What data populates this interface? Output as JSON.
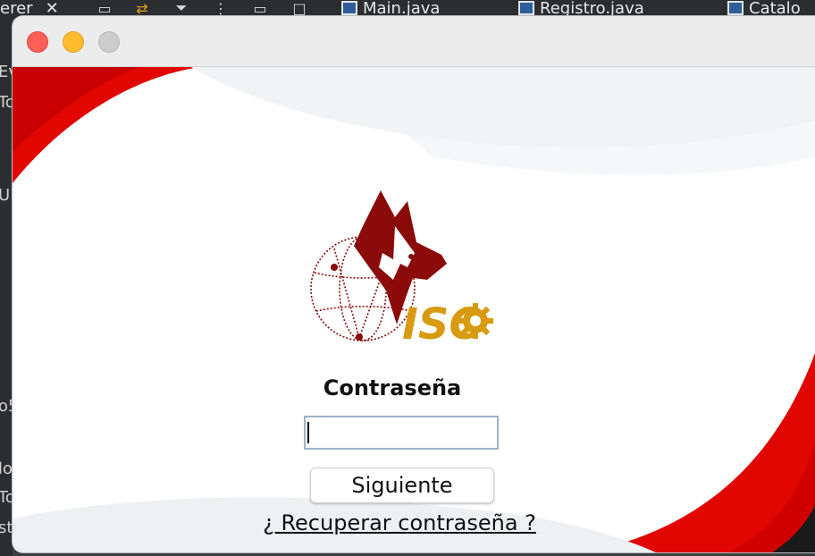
{
  "ide": {
    "tabs": [
      {
        "label": "erer"
      },
      {
        "label": "Main.java"
      },
      {
        "label": "Registro.java"
      },
      {
        "label": "Catalo"
      }
    ],
    "close_glyph": "✕",
    "side_fragments": [
      "Ev",
      "To",
      "UI",
      "o5",
      "lo",
      "To",
      "st"
    ]
  },
  "window": {
    "title": ""
  },
  "login": {
    "label": "Contraseña",
    "password_value": "",
    "next_button": "Siguiente",
    "recover_link": "¿ Recuperar contraseña ?"
  },
  "logo": {
    "text": "ISC"
  },
  "colors": {
    "brand_red": "#e10600",
    "logo_dark_red": "#8b0a0a",
    "logo_gold": "#d89a10",
    "background_wave": "#f2f3f4"
  }
}
